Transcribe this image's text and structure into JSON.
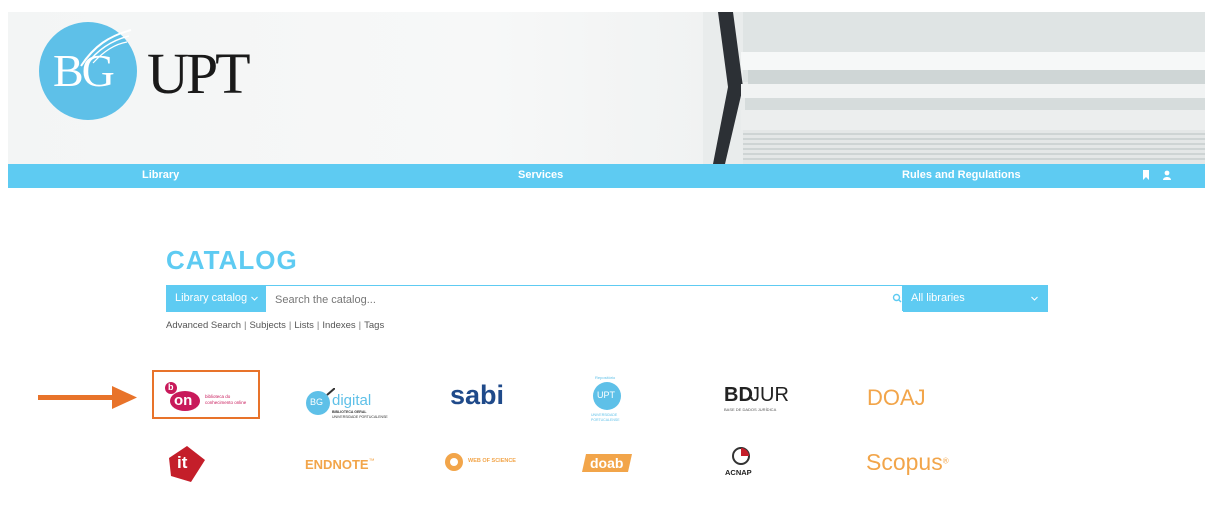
{
  "header": {
    "logo_bg": "BG",
    "logo_upt": "UPT"
  },
  "nav": {
    "library": "Library",
    "services": "Services",
    "rules": "Rules and Regulations",
    "icons": [
      "bookmark-icon",
      "user-icon"
    ]
  },
  "catalog": {
    "title": "CATALOG",
    "scope_select": "Library catalog",
    "search_placeholder": "Search the catalog...",
    "library_select": "All libraries",
    "links": [
      "Advanced Search",
      "Subjects",
      "Lists",
      "Indexes",
      "Tags"
    ]
  },
  "resources": {
    "b_on": {
      "mark": "on",
      "letter": "b",
      "caption1": "biblioteca do",
      "caption2": "conhecimento online"
    },
    "bg_digital": {
      "badge": "BG",
      "name": "digital",
      "caption1": "BIBLIOTECA GERAL",
      "caption2": "UNIVERSIDADE PORTUCALENSE"
    },
    "sabi": "sabi",
    "upt_repo": {
      "top": "Repositório",
      "badge": "UPT",
      "caption1": "UNIVERSIDADE",
      "caption2": "PORTUCALENSE"
    },
    "bdjur": {
      "bold": "BD",
      "light": "JUR",
      "caption": "BASE DE DADOS JURÍDICA"
    },
    "doaj": "DOAJ",
    "it": "it",
    "endnote": "ENDNOTE",
    "endnote_tm": "™",
    "wos": "WEB OF SCIENCE",
    "doab": "doab",
    "acnap": "ACNAP",
    "scopus": "Scopus",
    "scopus_reg": "®"
  },
  "colors": {
    "accent": "#5ecbf2",
    "highlight": "#e8732a"
  }
}
